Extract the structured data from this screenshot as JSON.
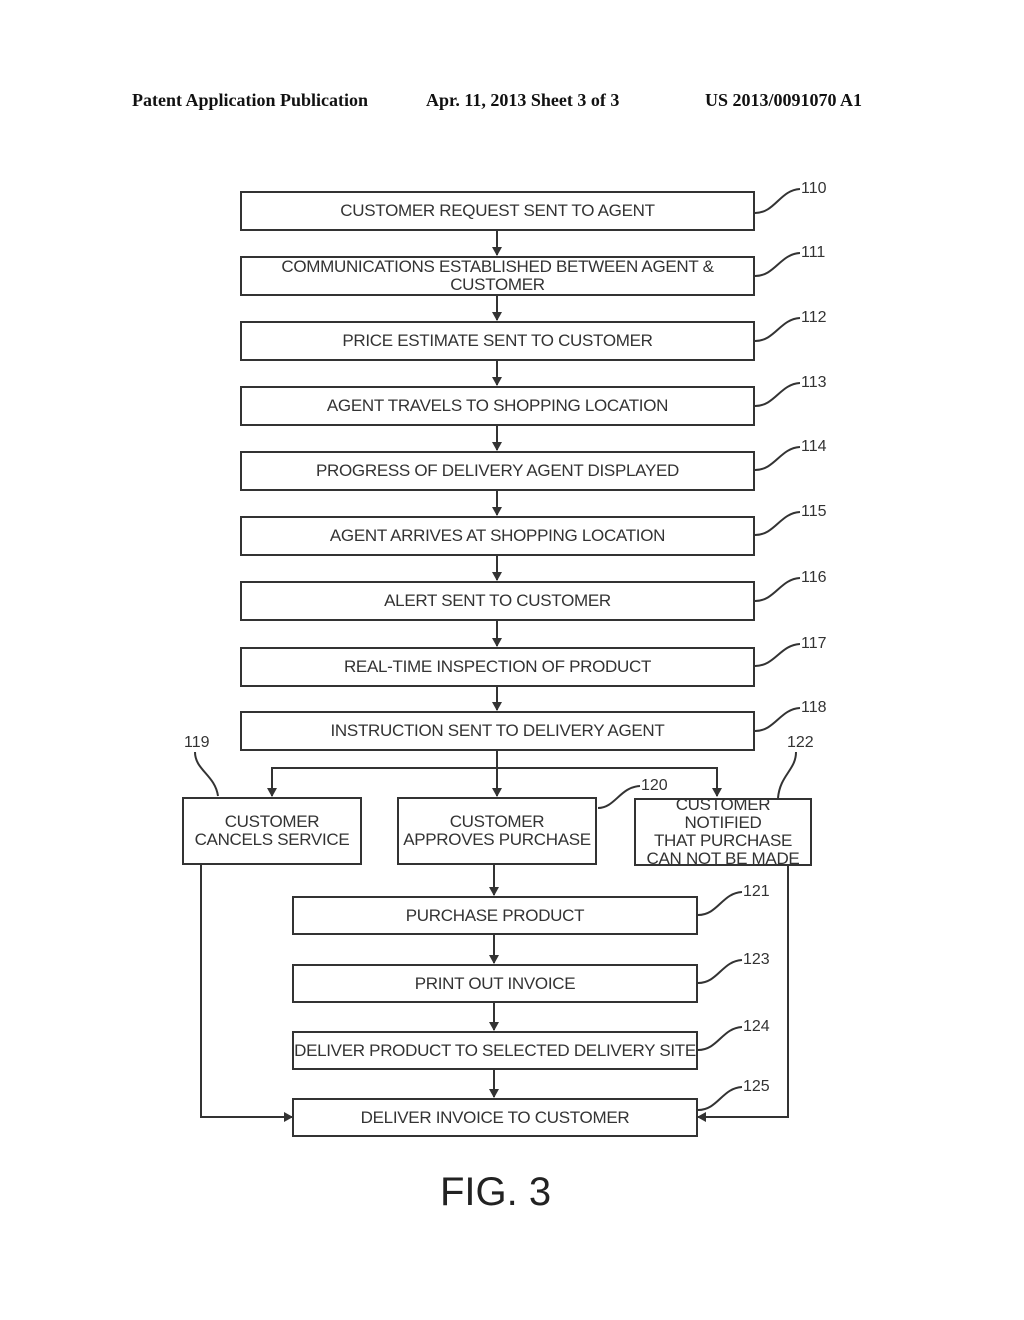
{
  "header": {
    "publication": "Patent Application Publication",
    "date_sheet": "Apr. 11, 2013  Sheet 3 of 3",
    "number": "US 2013/0091070 A1"
  },
  "steps": [
    {
      "ref": "110",
      "label": "CUSTOMER REQUEST SENT TO AGENT"
    },
    {
      "ref": "111",
      "label": "COMMUNICATIONS ESTABLISHED BETWEEN AGENT & CUSTOMER"
    },
    {
      "ref": "112",
      "label": "PRICE ESTIMATE SENT TO CUSTOMER"
    },
    {
      "ref": "113",
      "label": "AGENT TRAVELS TO SHOPPING LOCATION"
    },
    {
      "ref": "114",
      "label": "PROGRESS OF DELIVERY AGENT DISPLAYED"
    },
    {
      "ref": "115",
      "label": "AGENT ARRIVES AT SHOPPING LOCATION"
    },
    {
      "ref": "116",
      "label": "ALERT SENT TO CUSTOMER"
    },
    {
      "ref": "117",
      "label": "REAL-TIME INSPECTION OF PRODUCT"
    },
    {
      "ref": "118",
      "label": "INSTRUCTION SENT TO DELIVERY AGENT"
    }
  ],
  "branches": [
    {
      "ref": "119",
      "label": "CUSTOMER\nCANCELS SERVICE"
    },
    {
      "ref": "120",
      "label": "CUSTOMER\nAPPROVES PURCHASE"
    },
    {
      "ref": "122",
      "label": "CUSTOMER NOTIFIED\nTHAT PURCHASE\nCAN NOT BE MADE"
    }
  ],
  "lower_steps": [
    {
      "ref": "121",
      "label": "PURCHASE PRODUCT"
    },
    {
      "ref": "123",
      "label": "PRINT OUT INVOICE"
    },
    {
      "ref": "124",
      "label": "DELIVER PRODUCT TO SELECTED DELIVERY SITE"
    },
    {
      "ref": "125",
      "label": "DELIVER INVOICE TO CUSTOMER"
    }
  ],
  "figure_label": "FIG. 3"
}
